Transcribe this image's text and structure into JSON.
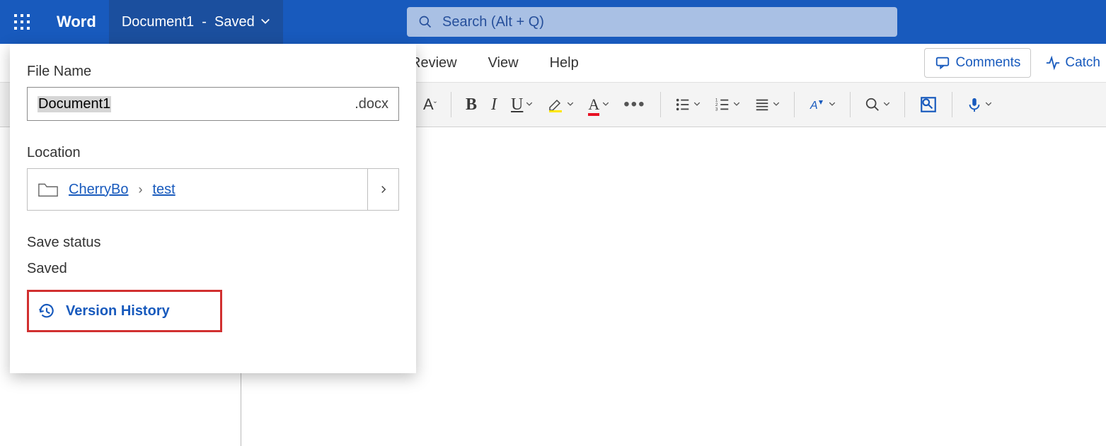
{
  "header": {
    "app_name": "Word",
    "doc_title": "Document1",
    "saved_indicator": "Saved",
    "search_placeholder": "Search (Alt + Q)"
  },
  "ribbon": {
    "tabs": {
      "review": "Review",
      "view": "View",
      "help": "Help"
    },
    "comments_label": "Comments",
    "catch_label": "Catch"
  },
  "popover": {
    "filename_label": "File Name",
    "filename_value": "Document1",
    "extension": ".docx",
    "location_label": "Location",
    "location_root": "CherryBo",
    "location_child": "test",
    "save_status_label": "Save status",
    "save_status_value": "Saved",
    "version_history_label": "Version History"
  }
}
